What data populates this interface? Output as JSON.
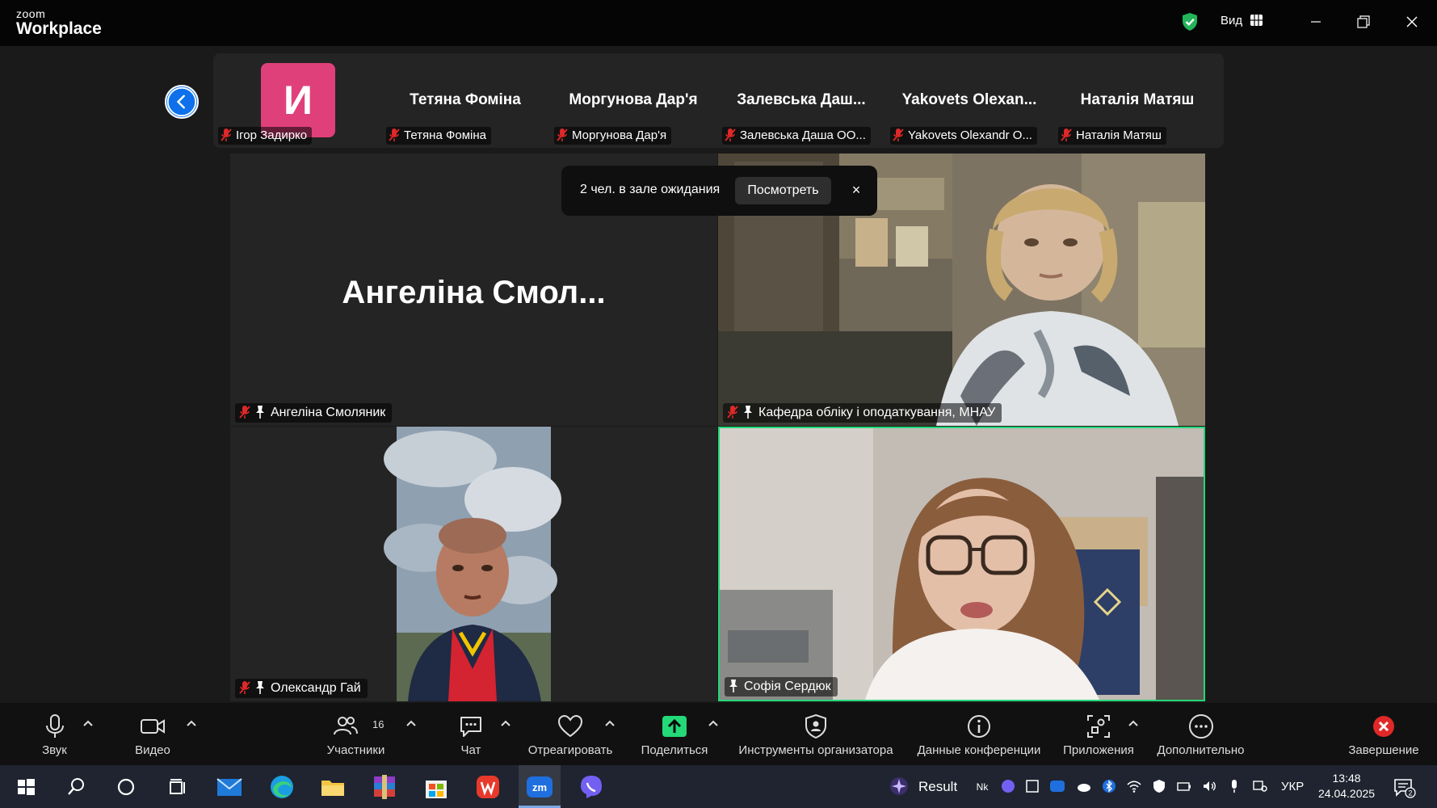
{
  "titlebar": {
    "brand_small": "zoom",
    "brand_big": "Workplace",
    "view_label": "Вид"
  },
  "strip": {
    "tiles": [
      {
        "avatar_letter": "И",
        "label": "Ігор Задирко",
        "muted": true
      },
      {
        "bigname": "Тетяна Фоміна",
        "label": "Тетяна Фоміна",
        "muted": true
      },
      {
        "bigname": "Моргунова Дар'я",
        "label": "Моргунова Дар'я",
        "muted": true
      },
      {
        "bigname": "Залевська Даш...",
        "label": "Залевська Даша ОО...",
        "muted": true
      },
      {
        "bigname": "Yakovets Olexan...",
        "label": "Yakovets Olexandr O...",
        "muted": true
      },
      {
        "bigname": "Наталія Матяш",
        "label": "Наталія Матяш",
        "muted": true
      }
    ]
  },
  "waiting_room": {
    "text": "2 чел. в зале ожидания",
    "view_button": "Посмотреть",
    "close": "×"
  },
  "tiles": [
    {
      "bigname": "Ангеліна Смол...",
      "label": "Ангеліна Смоляник",
      "muted": true,
      "pinned": true
    },
    {
      "label": "Кафедра обліку і оподаткування, МНАУ",
      "muted": true,
      "pinned": true
    },
    {
      "label": "Олександр Гай",
      "muted": true,
      "pinned": true
    },
    {
      "label": "Софія Сердюк",
      "muted": false,
      "pinned": true,
      "active_speaker": true
    }
  ],
  "toolbar": {
    "audio": "Звук",
    "video": "Видео",
    "participants": "Участники",
    "participants_count": "16",
    "chat": "Чат",
    "react": "Отреагировать",
    "share": "Поделиться",
    "host_tools": "Инструменты организатора",
    "meeting_info": "Данные конференции",
    "apps": "Приложения",
    "more": "Дополнительно",
    "end": "Завершение"
  },
  "taskbar": {
    "result_label": "Result",
    "language": "УКР",
    "time": "13:48",
    "date": "24.04.2025",
    "notifications": "2"
  },
  "colors": {
    "active_speaker_border": "#23d978",
    "share_green": "#23d978",
    "end_red": "#e02828",
    "back_button_blue": "#0e71eb",
    "avatar_pink": "#e0407a"
  }
}
